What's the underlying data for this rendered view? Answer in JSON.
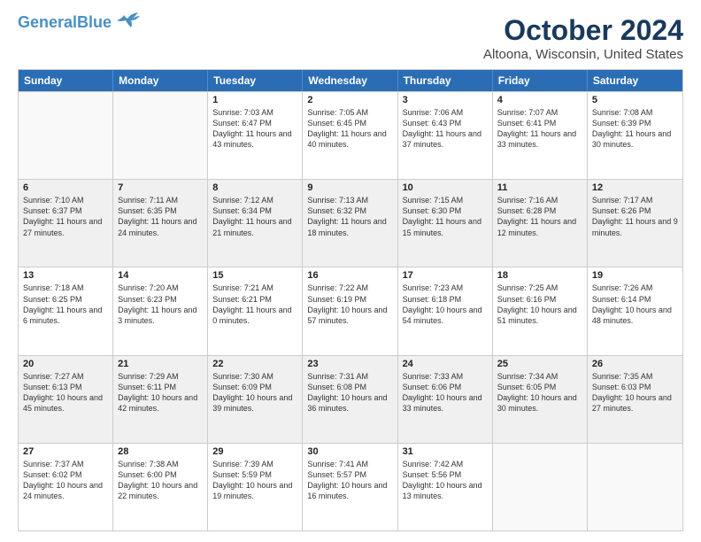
{
  "header": {
    "logo_line1": "General",
    "logo_line2": "Blue",
    "month_title": "October 2024",
    "location": "Altoona, Wisconsin, United States"
  },
  "days_of_week": [
    "Sunday",
    "Monday",
    "Tuesday",
    "Wednesday",
    "Thursday",
    "Friday",
    "Saturday"
  ],
  "weeks": [
    [
      {
        "day": "",
        "empty": true
      },
      {
        "day": "",
        "empty": true
      },
      {
        "day": "1",
        "sunrise": "7:03 AM",
        "sunset": "6:47 PM",
        "daylight": "11 hours and 43 minutes."
      },
      {
        "day": "2",
        "sunrise": "7:05 AM",
        "sunset": "6:45 PM",
        "daylight": "11 hours and 40 minutes."
      },
      {
        "day": "3",
        "sunrise": "7:06 AM",
        "sunset": "6:43 PM",
        "daylight": "11 hours and 37 minutes."
      },
      {
        "day": "4",
        "sunrise": "7:07 AM",
        "sunset": "6:41 PM",
        "daylight": "11 hours and 33 minutes."
      },
      {
        "day": "5",
        "sunrise": "7:08 AM",
        "sunset": "6:39 PM",
        "daylight": "11 hours and 30 minutes."
      }
    ],
    [
      {
        "day": "6",
        "sunrise": "7:10 AM",
        "sunset": "6:37 PM",
        "daylight": "11 hours and 27 minutes."
      },
      {
        "day": "7",
        "sunrise": "7:11 AM",
        "sunset": "6:35 PM",
        "daylight": "11 hours and 24 minutes."
      },
      {
        "day": "8",
        "sunrise": "7:12 AM",
        "sunset": "6:34 PM",
        "daylight": "11 hours and 21 minutes."
      },
      {
        "day": "9",
        "sunrise": "7:13 AM",
        "sunset": "6:32 PM",
        "daylight": "11 hours and 18 minutes."
      },
      {
        "day": "10",
        "sunrise": "7:15 AM",
        "sunset": "6:30 PM",
        "daylight": "11 hours and 15 minutes."
      },
      {
        "day": "11",
        "sunrise": "7:16 AM",
        "sunset": "6:28 PM",
        "daylight": "11 hours and 12 minutes."
      },
      {
        "day": "12",
        "sunrise": "7:17 AM",
        "sunset": "6:26 PM",
        "daylight": "11 hours and 9 minutes."
      }
    ],
    [
      {
        "day": "13",
        "sunrise": "7:18 AM",
        "sunset": "6:25 PM",
        "daylight": "11 hours and 6 minutes."
      },
      {
        "day": "14",
        "sunrise": "7:20 AM",
        "sunset": "6:23 PM",
        "daylight": "11 hours and 3 minutes."
      },
      {
        "day": "15",
        "sunrise": "7:21 AM",
        "sunset": "6:21 PM",
        "daylight": "11 hours and 0 minutes."
      },
      {
        "day": "16",
        "sunrise": "7:22 AM",
        "sunset": "6:19 PM",
        "daylight": "10 hours and 57 minutes."
      },
      {
        "day": "17",
        "sunrise": "7:23 AM",
        "sunset": "6:18 PM",
        "daylight": "10 hours and 54 minutes."
      },
      {
        "day": "18",
        "sunrise": "7:25 AM",
        "sunset": "6:16 PM",
        "daylight": "10 hours and 51 minutes."
      },
      {
        "day": "19",
        "sunrise": "7:26 AM",
        "sunset": "6:14 PM",
        "daylight": "10 hours and 48 minutes."
      }
    ],
    [
      {
        "day": "20",
        "sunrise": "7:27 AM",
        "sunset": "6:13 PM",
        "daylight": "10 hours and 45 minutes."
      },
      {
        "day": "21",
        "sunrise": "7:29 AM",
        "sunset": "6:11 PM",
        "daylight": "10 hours and 42 minutes."
      },
      {
        "day": "22",
        "sunrise": "7:30 AM",
        "sunset": "6:09 PM",
        "daylight": "10 hours and 39 minutes."
      },
      {
        "day": "23",
        "sunrise": "7:31 AM",
        "sunset": "6:08 PM",
        "daylight": "10 hours and 36 minutes."
      },
      {
        "day": "24",
        "sunrise": "7:33 AM",
        "sunset": "6:06 PM",
        "daylight": "10 hours and 33 minutes."
      },
      {
        "day": "25",
        "sunrise": "7:34 AM",
        "sunset": "6:05 PM",
        "daylight": "10 hours and 30 minutes."
      },
      {
        "day": "26",
        "sunrise": "7:35 AM",
        "sunset": "6:03 PM",
        "daylight": "10 hours and 27 minutes."
      }
    ],
    [
      {
        "day": "27",
        "sunrise": "7:37 AM",
        "sunset": "6:02 PM",
        "daylight": "10 hours and 24 minutes."
      },
      {
        "day": "28",
        "sunrise": "7:38 AM",
        "sunset": "6:00 PM",
        "daylight": "10 hours and 22 minutes."
      },
      {
        "day": "29",
        "sunrise": "7:39 AM",
        "sunset": "5:59 PM",
        "daylight": "10 hours and 19 minutes."
      },
      {
        "day": "30",
        "sunrise": "7:41 AM",
        "sunset": "5:57 PM",
        "daylight": "10 hours and 16 minutes."
      },
      {
        "day": "31",
        "sunrise": "7:42 AM",
        "sunset": "5:56 PM",
        "daylight": "10 hours and 13 minutes."
      },
      {
        "day": "",
        "empty": true
      },
      {
        "day": "",
        "empty": true
      }
    ]
  ]
}
